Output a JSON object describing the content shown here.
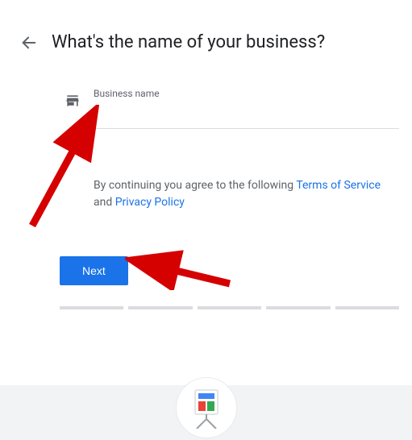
{
  "header": {
    "title": "What's the name of your business?"
  },
  "form": {
    "label": "Business name",
    "value": ""
  },
  "consent": {
    "prefix": "By continuing you agree to the following ",
    "terms": "Terms of Service",
    "and": " and ",
    "privacy": "Privacy Policy"
  },
  "actions": {
    "next": "Next"
  },
  "progress": {
    "steps": 5
  }
}
